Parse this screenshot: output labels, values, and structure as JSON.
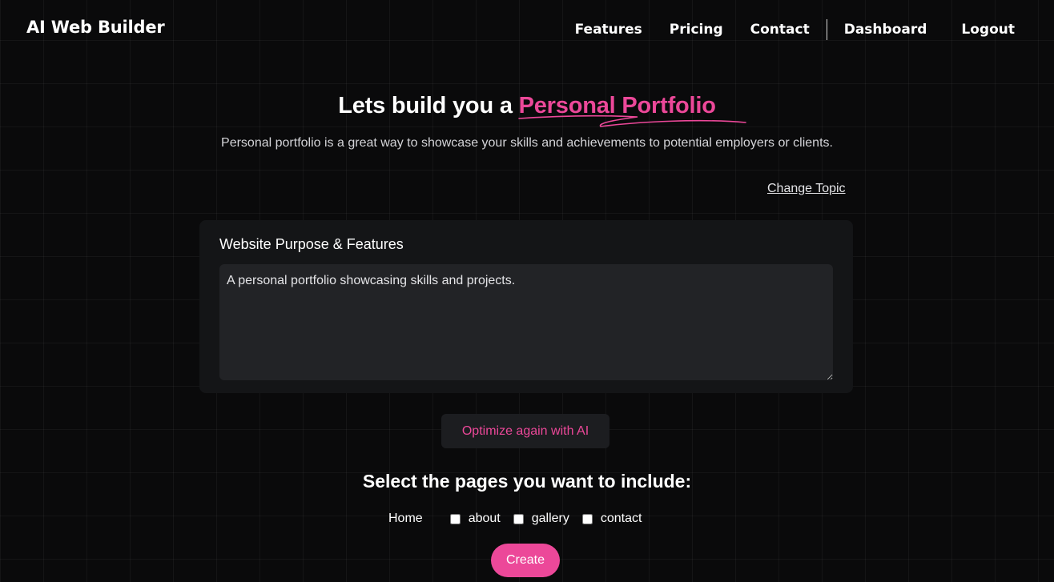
{
  "brand": "AI Web Builder",
  "nav": {
    "features": "Features",
    "pricing": "Pricing",
    "contact": "Contact",
    "dashboard": "Dashboard",
    "logout": "Logout"
  },
  "hero": {
    "title_prefix": "Lets build you a ",
    "title_highlight": "Personal Portfolio",
    "subtitle": "Personal portfolio is a great way to showcase your skills and achievements to potential employers or clients.",
    "change_topic": "Change Topic"
  },
  "purpose": {
    "label": "Website Purpose & Features",
    "value": "A personal portfolio showcasing skills and projects."
  },
  "optimize_label": "Optimize again with AI",
  "pages": {
    "title": "Select the pages you want to include:",
    "home": "Home",
    "options": [
      {
        "label": "about",
        "checked": false
      },
      {
        "label": "gallery",
        "checked": false
      },
      {
        "label": "contact",
        "checked": false
      }
    ]
  },
  "create_label": "Create",
  "colors": {
    "accent": "#ec4899",
    "background": "#0a0a0b",
    "card": "#141517"
  }
}
